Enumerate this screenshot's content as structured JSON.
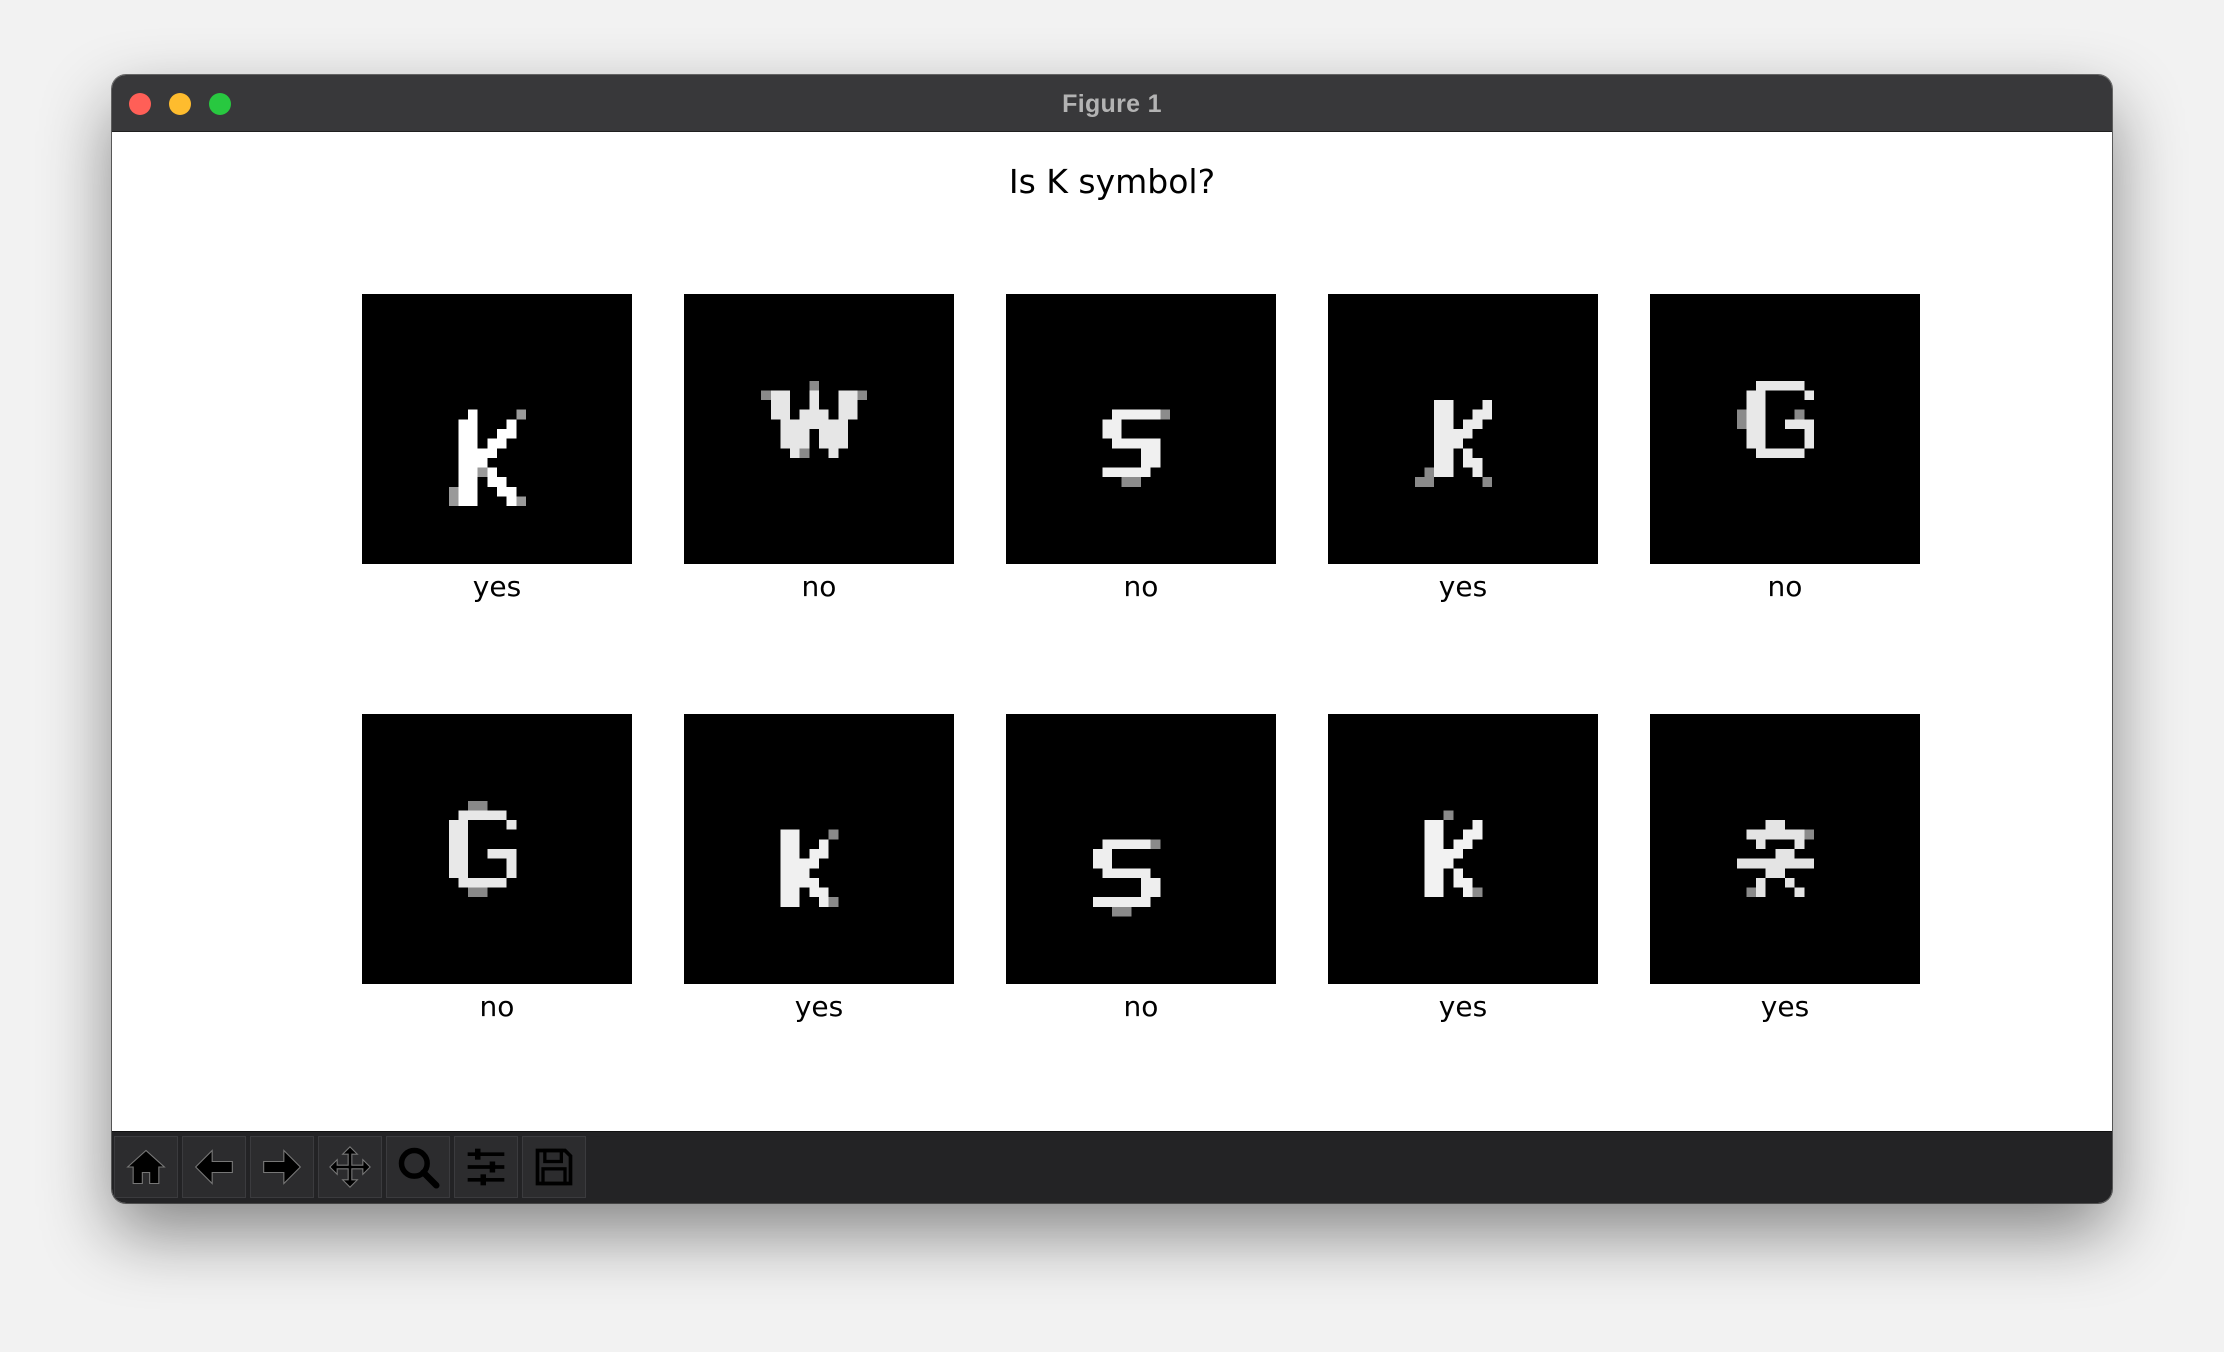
{
  "window": {
    "title": "Figure 1"
  },
  "figure": {
    "suptitle": "Is K symbol?",
    "panels": [
      {
        "label": "yes",
        "glyph": "K"
      },
      {
        "label": "no",
        "glyph": "W"
      },
      {
        "label": "no",
        "glyph": "s"
      },
      {
        "label": "yes",
        "glyph": "K"
      },
      {
        "label": "no",
        "glyph": "G"
      },
      {
        "label": "no",
        "glyph": "G"
      },
      {
        "label": "yes",
        "glyph": "K"
      },
      {
        "label": "no",
        "glyph": "S"
      },
      {
        "label": "yes",
        "glyph": "K"
      },
      {
        "label": "yes",
        "glyph": "犬"
      }
    ]
  },
  "toolbar": {
    "buttons": [
      {
        "name": "home-icon"
      },
      {
        "name": "back-arrow-icon"
      },
      {
        "name": "forward-arrow-icon"
      },
      {
        "name": "pan-move-icon"
      },
      {
        "name": "zoom-magnifier-icon"
      },
      {
        "name": "configure-subplots-icon"
      },
      {
        "name": "save-floppy-icon"
      }
    ]
  },
  "colors": {
    "titlebar": "#38383a",
    "toolbar": "#232325",
    "close": "#ff5f57",
    "minimize": "#febc2e",
    "zoom": "#28c840"
  }
}
